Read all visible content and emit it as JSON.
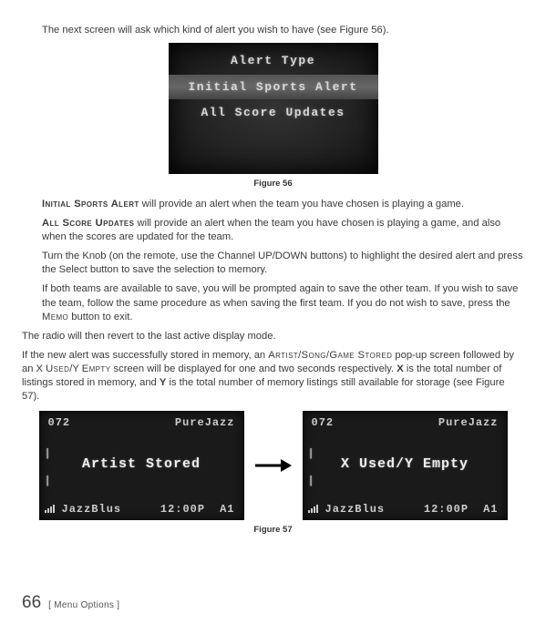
{
  "intro": "The next screen will ask which kind of alert you wish to have (see Figure 56).",
  "figure56": {
    "title": "Alert Type",
    "option_selected": "Initial Sports Alert",
    "option_other": "All Score Updates",
    "label": "Figure 56"
  },
  "body": {
    "p1_label": "Initial Sports Alert",
    "p1_text": " will provide an alert when the team you have chosen is playing a game.",
    "p2_label": "All Score Updates",
    "p2_text": " will provide an alert when the team you have chosen is playing a game, and also when the scores are updated for the team.",
    "p3": "Turn the Knob (on the remote, use the Channel UP/DOWN buttons) to highlight the desired alert and press the Select button to save the selection to memory.",
    "p4_a": "If both teams are available to save, you will be prompted again to save the other team. If you wish to save the team, follow the same procedure as when saving the first team. If you do not wish to save, press the ",
    "p4_sc": "Memo",
    "p4_b": " button to exit.",
    "p5": "The radio will then revert to the last active display mode.",
    "p6_a": "If the new alert was successfully stored in memory, an ",
    "p6_sc1": "Artist/Song/Game Stored",
    "p6_b": " pop-up screen followed by an X ",
    "p6_sc2": "Used",
    "p6_c": "/Y ",
    "p6_sc3": "Empty",
    "p6_d": " screen will be displayed for one and two seconds respectively. ",
    "p6_e_bold1": "X",
    "p6_f": " is the total number of listings stored in memory, and ",
    "p6_e_bold2": "Y",
    "p6_g": " is the total number of memory listings still available for storage (see Figure 57)."
  },
  "figure57": {
    "left": {
      "ch": "072",
      "name": "PureJazz",
      "mid": "Artist Stored",
      "bot_left": "JazzBlus",
      "bot_time": "12:00P",
      "bot_preset": "A1"
    },
    "right": {
      "ch": "072",
      "name": "PureJazz",
      "mid": "X Used/Y Empty",
      "bot_left": "JazzBlus",
      "bot_time": "12:00P",
      "bot_preset": "A1"
    },
    "label": "Figure 57"
  },
  "footer": {
    "page": "66",
    "chapter": "[ Menu Options ]"
  }
}
